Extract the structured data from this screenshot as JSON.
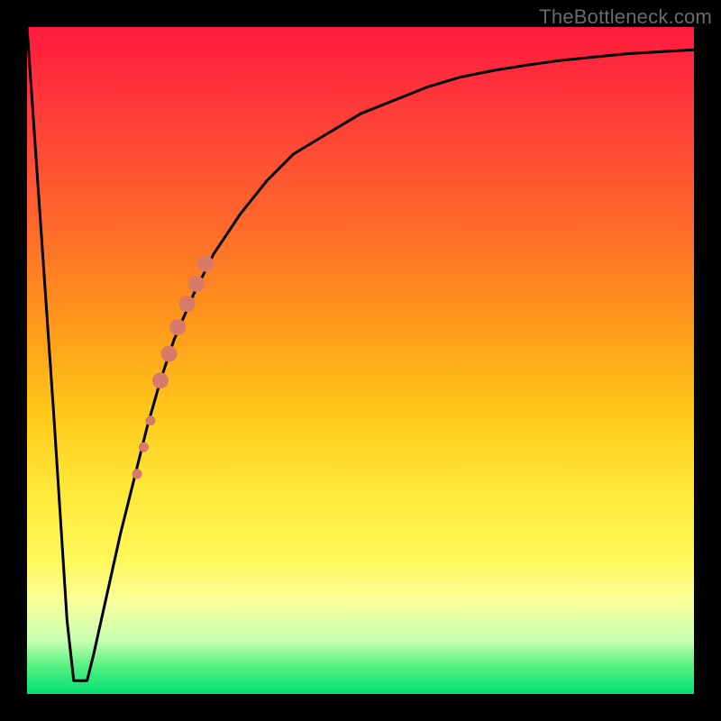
{
  "watermark": "TheBottleneck.com",
  "colors": {
    "frame": "#000000",
    "curve": "#000000",
    "marker": "#d87a6a",
    "gradient_top": "#ff1a3d",
    "gradient_bottom": "#00e070"
  },
  "chart_data": {
    "type": "line",
    "title": "",
    "xlabel": "",
    "ylabel": "",
    "xlim": [
      0,
      100
    ],
    "ylim": [
      0,
      100
    ],
    "series": [
      {
        "name": "bottleneck-curve",
        "x": [
          0,
          4,
          6,
          7,
          8,
          9,
          10,
          12,
          14,
          16,
          18,
          20,
          22,
          25,
          28,
          32,
          36,
          40,
          45,
          50,
          55,
          60,
          65,
          70,
          75,
          80,
          85,
          90,
          95,
          100
        ],
        "y": [
          100,
          42,
          11,
          2,
          2,
          2,
          6,
          15,
          24,
          32,
          40,
          47,
          53,
          60,
          66,
          72,
          77,
          81,
          84,
          87,
          89,
          91,
          92.5,
          93.5,
          94.3,
          95,
          95.5,
          96,
          96.3,
          96.6
        ]
      }
    ],
    "markers": [
      {
        "x": 16.5,
        "y": 33,
        "r": 5.5
      },
      {
        "x": 17.5,
        "y": 37,
        "r": 5.5
      },
      {
        "x": 18.5,
        "y": 41,
        "r": 5.5
      },
      {
        "x": 20.0,
        "y": 47,
        "r": 9.0
      },
      {
        "x": 21.3,
        "y": 51,
        "r": 9.0
      },
      {
        "x": 22.6,
        "y": 55,
        "r": 9.0
      },
      {
        "x": 24.0,
        "y": 58.5,
        "r": 9.0
      },
      {
        "x": 25.4,
        "y": 61.5,
        "r": 9.0
      },
      {
        "x": 26.8,
        "y": 64.5,
        "r": 9.0
      }
    ],
    "annotations": []
  }
}
